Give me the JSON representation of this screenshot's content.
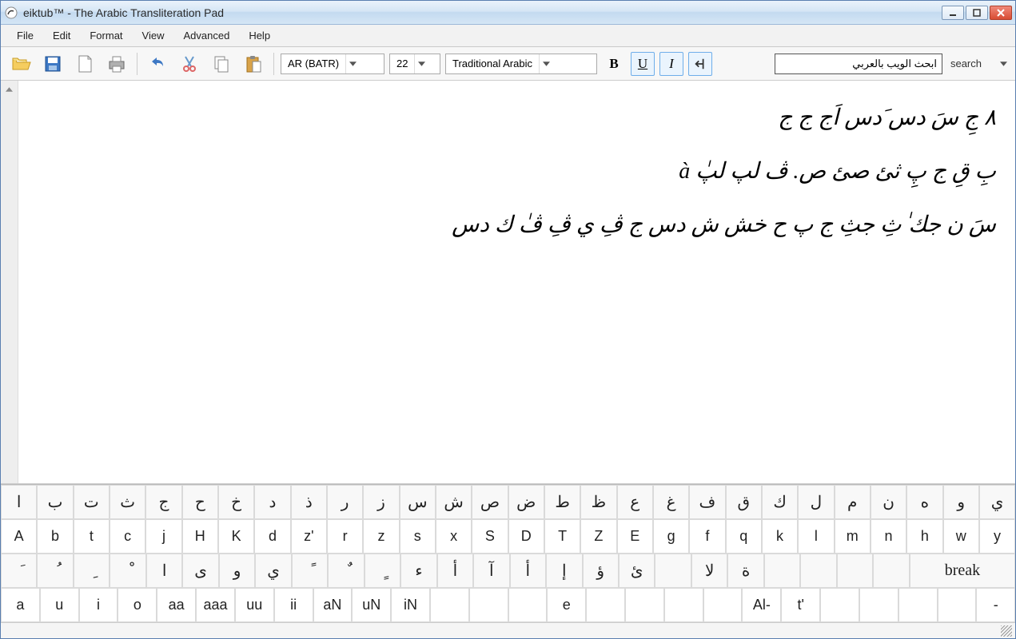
{
  "window": {
    "title": "eiktub™ - The Arabic Transliteration Pad"
  },
  "menu": {
    "items": [
      "File",
      "Edit",
      "Format",
      "View",
      "Advanced",
      "Help"
    ]
  },
  "toolbar": {
    "transliteration_system": "AR (BATR)",
    "font_size": "22",
    "font_name": "Traditional Arabic",
    "bold": "B",
    "underline": "U",
    "italic": "I",
    "bold_active": false,
    "underline_active": true,
    "italic_active": true,
    "rtl_active": true
  },
  "search": {
    "placeholder": "ابحث الويب بالعربي",
    "button": "search"
  },
  "editor": {
    "lines": [
      "٨ جِ سَ دس َدس اَج ج ج",
      "بِ قِ ج پِ ثئ صئ ص. ڤ لپ لپٰ à",
      "سَ ن جك ٰثِ جثِ ج پ ح خش ش دس ج ڤِ ي ڤِ ڤٰ ك دس"
    ]
  },
  "keyboard": {
    "row1": [
      "ا",
      "ب",
      "ت",
      "ث",
      "ج",
      "ح",
      "خ",
      "د",
      "ذ",
      "ر",
      "ز",
      "س",
      "ش",
      "ص",
      "ض",
      "ط",
      "ظ",
      "ع",
      "غ",
      "ف",
      "ق",
      "ك",
      "ل",
      "م",
      "ن",
      "ه",
      "و",
      "ي"
    ],
    "row2": [
      "A",
      "b",
      "t",
      "c",
      "j",
      "H",
      "K",
      "d",
      "z'",
      "r",
      "z",
      "s",
      "x",
      "S",
      "D",
      "T",
      "Z",
      "E",
      "g",
      "f",
      "q",
      "k",
      "l",
      "m",
      "n",
      "h",
      "w",
      "y"
    ],
    "row3": [
      "َ",
      "ُ",
      "ِ",
      "ْ",
      "ا",
      "ى",
      "و",
      "ي",
      "ً",
      "ٌ",
      "ٍ",
      "ء",
      "أ",
      "آ",
      "أ",
      "إ",
      "ؤ",
      "ئ",
      "",
      "لا",
      "ة",
      "",
      "",
      "",
      "",
      "break"
    ],
    "row4": [
      "a",
      "u",
      "i",
      "o",
      "aa",
      "aaa",
      "uu",
      "ii",
      "aN",
      "uN",
      "iN",
      "",
      "",
      "",
      "e",
      "",
      "",
      "",
      "",
      "Al-",
      "t'",
      "",
      "",
      "",
      "",
      "-"
    ]
  }
}
